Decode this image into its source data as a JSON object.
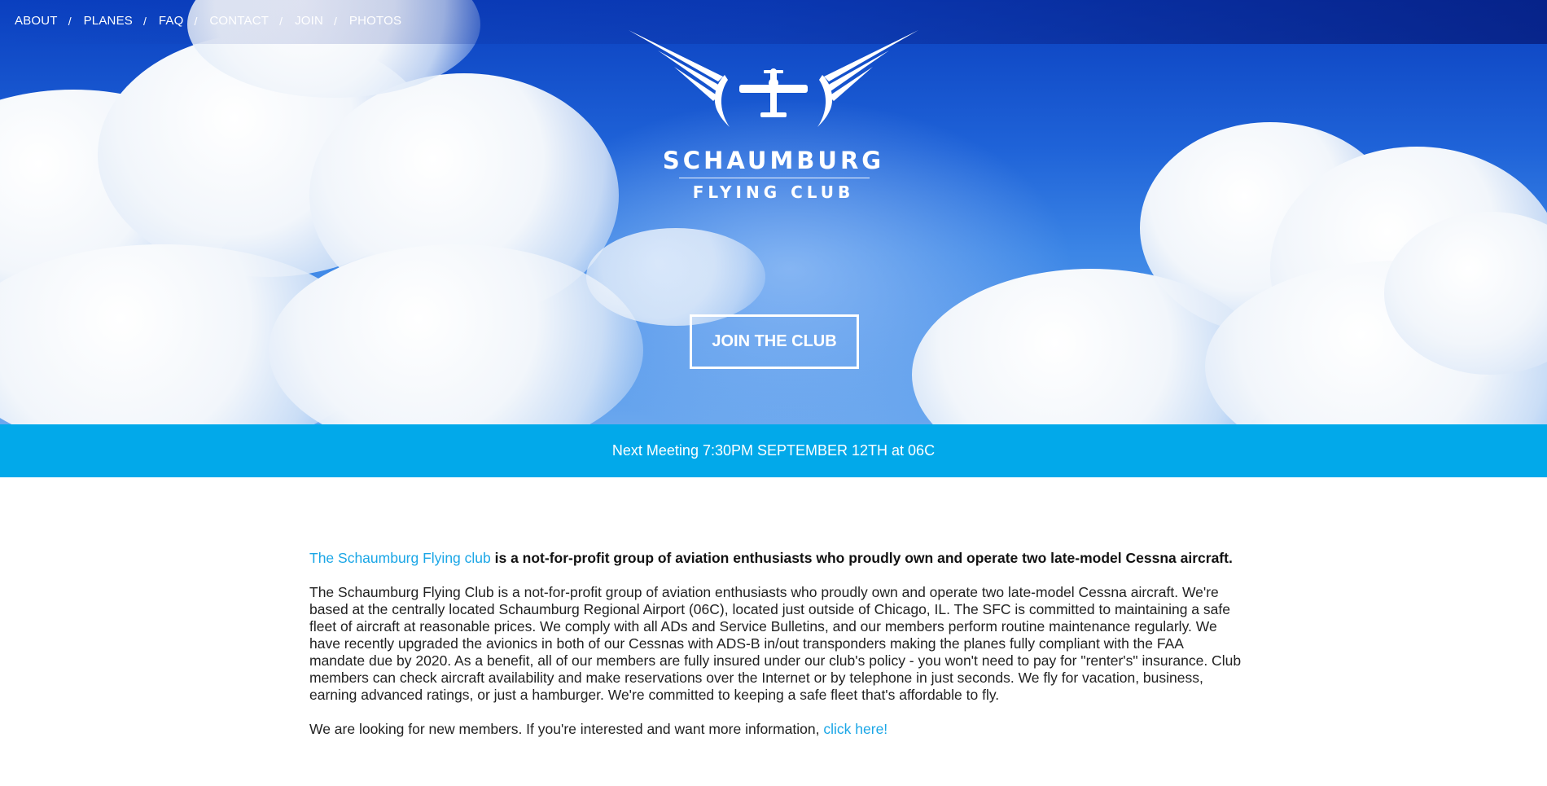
{
  "nav": {
    "items": [
      {
        "label": "ABOUT"
      },
      {
        "label": "PLANES"
      },
      {
        "label": "FAQ"
      },
      {
        "label": "CONTACT"
      },
      {
        "label": "JOIN"
      },
      {
        "label": "PHOTOS"
      }
    ],
    "separator": "/"
  },
  "logo": {
    "name": "SCHAUMBURG",
    "subtitle": "FLYING CLUB",
    "icon": "winged-airplane-icon"
  },
  "hero": {
    "cta_label": "JOIN THE CLUB"
  },
  "meeting": {
    "text": "Next Meeting 7:30PM SEPTEMBER 12TH at 06C"
  },
  "content": {
    "lead_link": "The Schaumburg Flying club",
    "lead_text": "is a not-for-profit group of aviation enthusiasts who proudly own and operate two late-model Cessna aircraft.",
    "body": "The Schaumburg Flying Club is a not-for-profit group of aviation enthusiasts who proudly own and operate two late-model Cessna aircraft. We're based at the centrally located Schaumburg Regional Airport (06C), located just outside of Chicago, IL. The SFC is committed to maintaining a safe fleet of aircraft at reasonable prices. We comply with all ADs and Service Bulletins, and our members perform routine maintenance regularly. We have recently upgraded the avionics in both of our Cessnas with ADS-B in/out transponders making the planes fully compliant with the FAA mandate due by 2020. As a benefit, all of our members are fully insured under our club's policy - you won't need to pay for \"renter's\" insurance. Club members can check aircraft availability and make reservations over the Internet or by telephone in just seconds. We fly for vacation, business, earning advanced ratings, or just a hamburger. We're committed to keeping a safe fleet that's affordable to fly.",
    "cta_text": "We are looking for new members. If you're interested and want more information,",
    "cta_link": "click here!"
  },
  "colors": {
    "accent": "#02a9ea",
    "link": "#1aa6e6",
    "sky_dark": "#0a3fbf"
  }
}
